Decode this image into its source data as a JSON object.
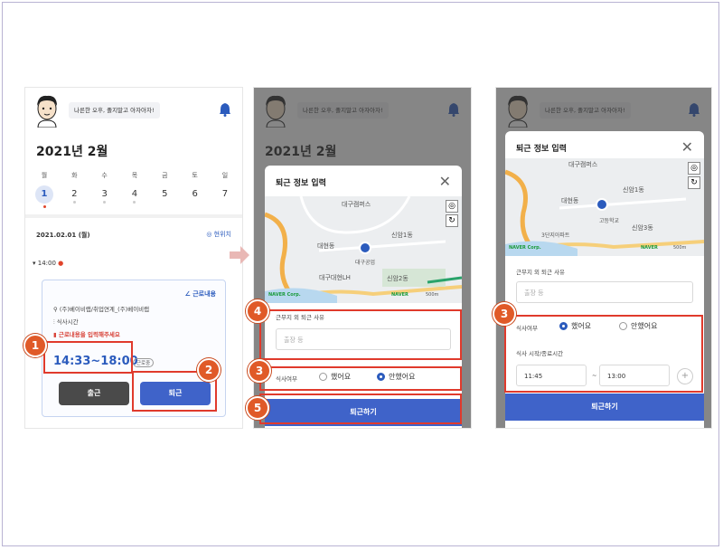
{
  "common": {
    "greeting": "나른한 오후, 졸지말고 아자아자!",
    "month": "2021년 2월",
    "days": [
      {
        "name": "월",
        "num": "1"
      },
      {
        "name": "화",
        "num": "2"
      },
      {
        "name": "수",
        "num": "3"
      },
      {
        "name": "목",
        "num": "4"
      },
      {
        "name": "금",
        "num": "5"
      },
      {
        "name": "토",
        "num": "6"
      },
      {
        "name": "일",
        "num": "7"
      }
    ]
  },
  "screen1": {
    "date": "2021.02.01 (월)",
    "now_label": "현위치",
    "time_group": "14:00",
    "content_link": "근로내용",
    "company": "(주)베이비랩/취업연계_(주)베이비랩",
    "meal": "식사시간",
    "warning": "근로내용을 입력해주세요",
    "hours": "14:33~18:00",
    "tag": "근로중",
    "clock_in": "출근",
    "clock_out": "퇴근"
  },
  "modal": {
    "title": "퇴근 정보 입력",
    "reason_label": "근무지 외 퇴근 사유",
    "reason_placeholder": "출장 등",
    "meal_label": "식사여부",
    "meal_yes": "했어요",
    "meal_no": "안했어요",
    "meal_time_label": "식사 시작/종료시간",
    "meal_start": "11:45",
    "meal_end": "13:00",
    "tilde": "~",
    "plus": "+",
    "submit": "퇴근하기",
    "close": "✕"
  },
  "map": {
    "labels": [
      "신암1동",
      "대현동",
      "신암3동",
      "신암2동",
      "대구대현LH",
      "3단지아파트",
      "대구공업",
      "고등학교",
      "대구캠퍼스"
    ],
    "naver": "NAVER Corp.",
    "naver_logo": "NAVER",
    "scale": "500m"
  },
  "badges": [
    "1",
    "2",
    "3",
    "4",
    "5"
  ],
  "colors": {
    "accent": "#3f63c9",
    "highlight": "#e03a2c",
    "badge": "#e05a28"
  }
}
